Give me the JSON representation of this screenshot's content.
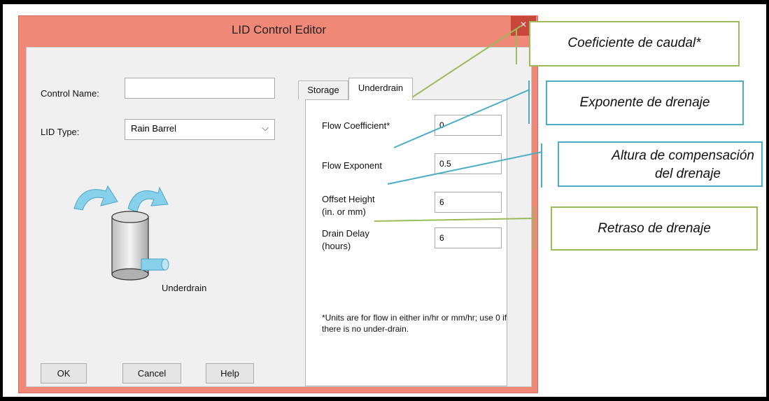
{
  "window": {
    "title": "LID Control Editor",
    "close_glyph": "×"
  },
  "form": {
    "control_name_label": "Control Name:",
    "control_name_value": "",
    "lid_type_label": "LID Type:",
    "lid_type_value": "Rain Barrel",
    "illustration_label": "Underdrain"
  },
  "buttons": {
    "ok": "OK",
    "cancel": "Cancel",
    "help": "Help"
  },
  "tabs": [
    {
      "label": "Storage",
      "active": false
    },
    {
      "label": "Underdrain",
      "active": true
    }
  ],
  "underdrain": {
    "flow_coefficient": {
      "label": "Flow Coefficient*",
      "value": "0"
    },
    "flow_exponent": {
      "label": "Flow Exponent",
      "value": "0.5"
    },
    "offset_height": {
      "label_line1": "Offset Height",
      "label_line2": "(in. or mm)",
      "value": "6"
    },
    "drain_delay": {
      "label_line1": "Drain Delay",
      "label_line2": "(hours)",
      "value": "6"
    },
    "note": "*Units are for flow in either in/hr or mm/hr; use 0 if there is no under-drain."
  },
  "callouts": {
    "flow_coefficient": "Coeficiente de caudal*",
    "flow_exponent": "Exponente de drenaje",
    "offset_height_line1": "Altura de compensación",
    "offset_height_line2": "del drenaje",
    "drain_delay": "Retraso de drenaje"
  },
  "colors": {
    "window_frame": "#f08878",
    "callout_green": "#9bbb59",
    "callout_blue": "#4bacc6",
    "arrow": "#7ecbe6"
  }
}
